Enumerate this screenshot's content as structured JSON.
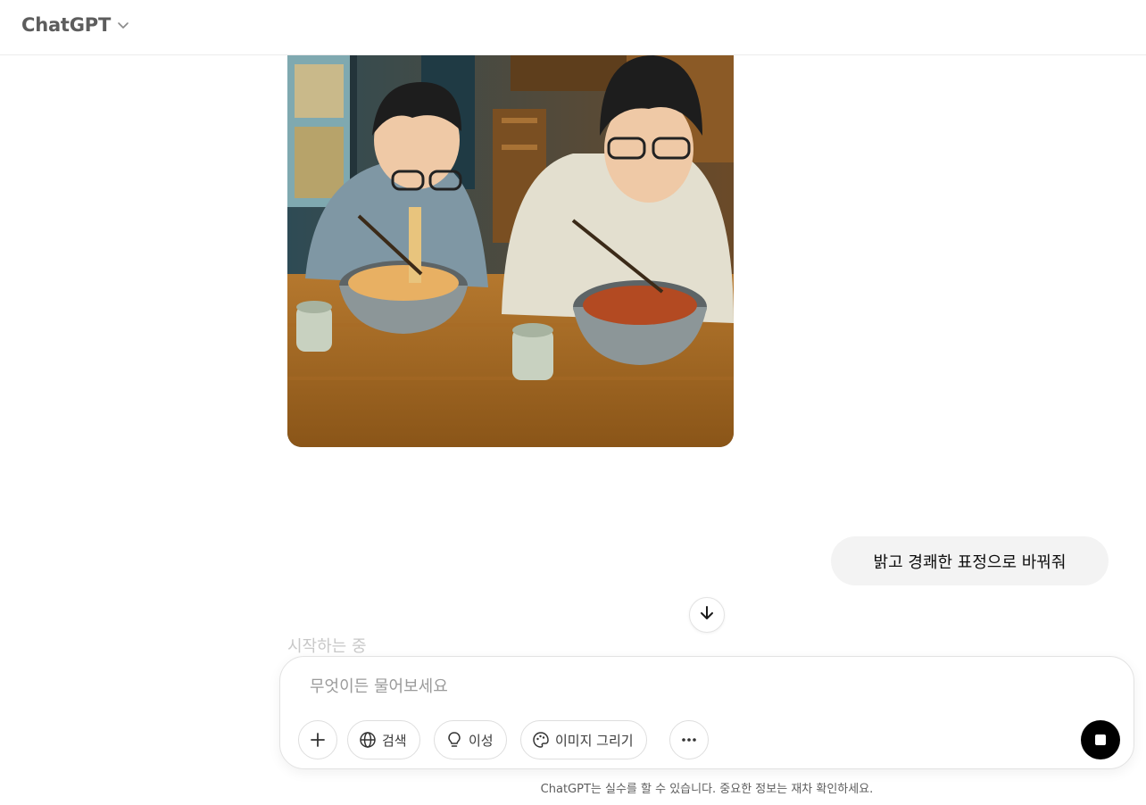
{
  "header": {
    "model_name": "ChatGPT"
  },
  "conversation": {
    "user_message": "밝고 경쾌한 표정으로 바꿔줘",
    "assistant_status": "시작하는 중"
  },
  "composer": {
    "placeholder": "무엇이든 물어보세요",
    "value": "",
    "tools": {
      "search": "검색",
      "reason": "이성",
      "image": "이미지 그리기"
    }
  },
  "footer": {
    "disclaimer": "ChatGPT는 실수를 할 수 있습니다. 중요한 정보는 재차 확인하세요."
  },
  "icons": {
    "model_chevron": "chevron-down-icon",
    "scroll": "arrow-down-icon",
    "add": "plus-icon",
    "search": "globe-icon",
    "reason": "lightbulb-icon",
    "image": "palette-icon",
    "more": "more-horizontal-icon",
    "stop": "stop-icon"
  },
  "colors": {
    "header_text": "#5d5d5d",
    "bubble_bg": "#f3f3f3",
    "stop_button": "#000000",
    "status_text": "#c8c8c8"
  }
}
